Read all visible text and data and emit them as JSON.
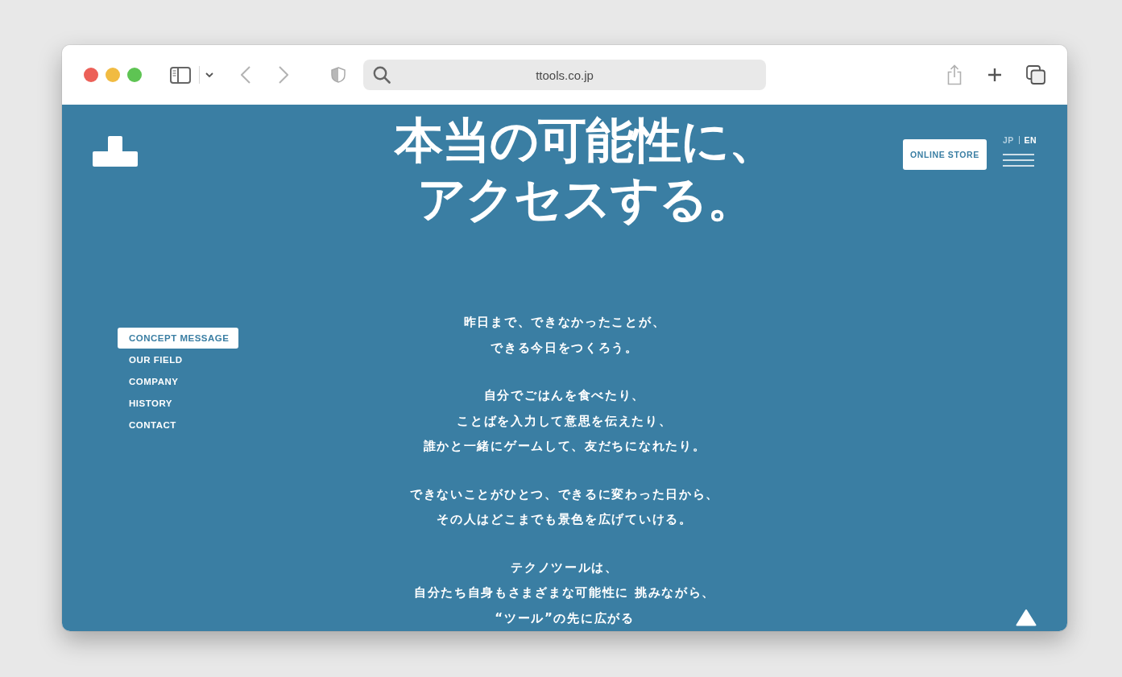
{
  "browser": {
    "address": "ttools.co.jp"
  },
  "page": {
    "headline": {
      "lines": [
        "本当の可能性に、",
        "アクセスする。"
      ]
    },
    "online_store_button": "ONLINE STORE",
    "languages": [
      {
        "label": "JP",
        "selected": true
      },
      {
        "label": "EN",
        "selected": false
      }
    ],
    "nav": [
      {
        "label": "CONCEPT MESSAGE",
        "selected": true
      },
      {
        "label": "OUR FIELD",
        "selected": false
      },
      {
        "label": "COMPANY",
        "selected": false
      },
      {
        "label": "HISTORY",
        "selected": false
      },
      {
        "label": "CONTACT",
        "selected": false
      }
    ],
    "message": [
      {
        "lines": [
          "昨日まで、できなかったことが、",
          "できる今日をつくろう。"
        ]
      },
      {
        "lines": [
          "自分でごはんを食べたり、",
          "ことばを入力して意思を伝えたり、",
          "誰かと一緒にゲームして、友だちになれたり。"
        ]
      },
      {
        "lines": [
          "できないことがひとつ、できるに変わった日から、",
          "その人はどこまでも景色を広げていける。"
        ]
      },
      {
        "lines": [
          "テクノツールは、",
          "自分たち自身もさまざまな可能性に 挑みながら、",
          "“ツール”の先に広がる"
        ]
      }
    ]
  }
}
